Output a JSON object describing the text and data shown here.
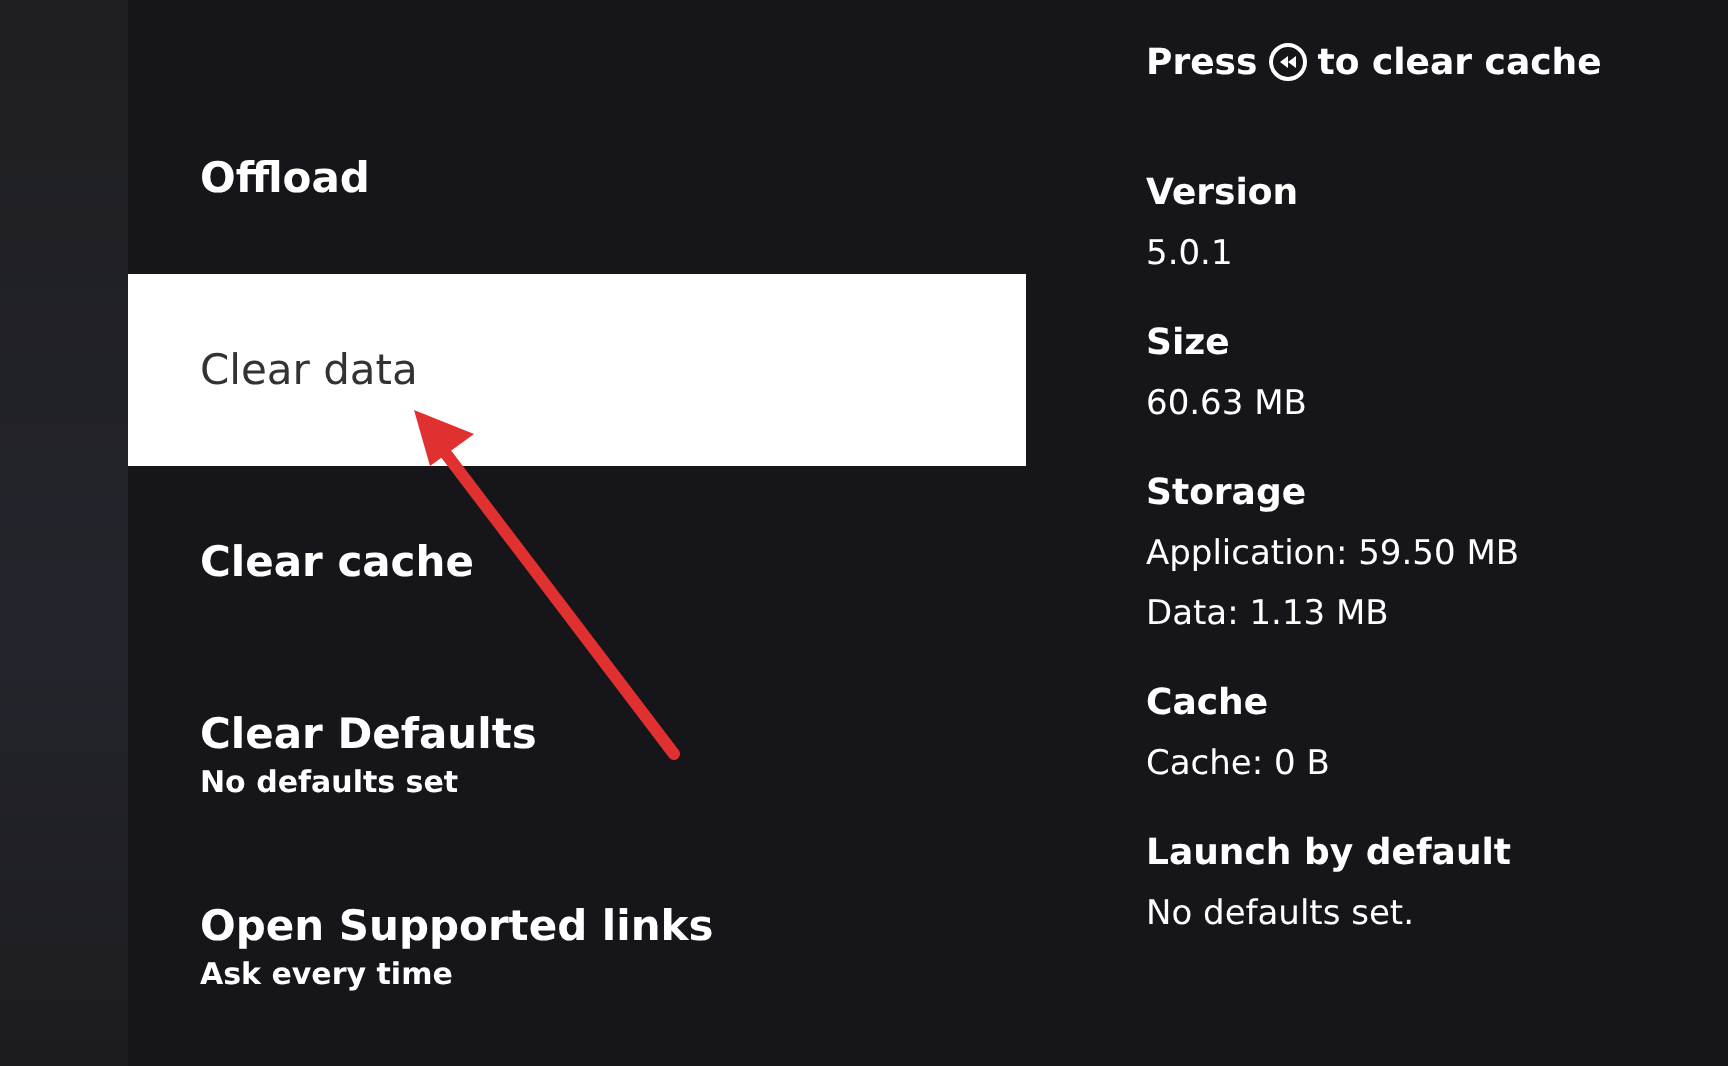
{
  "menu": [
    {
      "label": "Offload",
      "selected": false
    },
    {
      "label": "Clear data",
      "selected": true
    },
    {
      "label": "Clear cache",
      "selected": false
    },
    {
      "label": "Clear Defaults",
      "sublabel": "No defaults set",
      "selected": false
    },
    {
      "label": "Open Supported links",
      "sublabel": "Ask every time",
      "selected": false
    }
  ],
  "hint": {
    "before": "Press",
    "after": "to clear cache"
  },
  "details": [
    {
      "label": "Version",
      "values": [
        "5.0.1"
      ]
    },
    {
      "label": "Size",
      "values": [
        "60.63 MB"
      ]
    },
    {
      "label": "Storage",
      "values": [
        "Application: 59.50 MB",
        "Data: 1.13 MB"
      ]
    },
    {
      "label": "Cache",
      "values": [
        "Cache: 0 B"
      ]
    },
    {
      "label": "Launch by default",
      "values": [
        "No defaults set."
      ]
    }
  ]
}
